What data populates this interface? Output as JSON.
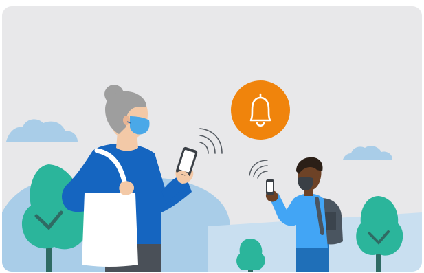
{
  "scene": {
    "icons": {
      "notification": "bell-icon",
      "signal": "wireless-signal-icon",
      "phone": "smartphone-icon"
    },
    "colors": {
      "background": "#e8e8ea",
      "hill": "#a9cde8",
      "cloud": "#a9cde8",
      "tree": "#2bb59b",
      "trunk": "#2f6b64",
      "bell_badge": "#f0840c",
      "jacket_woman": "#1565c0",
      "jacket_man": "#42a5f5",
      "mask": "#4aa8e8",
      "bag": "#ffffff",
      "hair_woman": "#9e9e9e",
      "skin_woman": "#f3c9a7",
      "skin_man": "#6d4226",
      "hair_man": "#2b1f17",
      "backpack": "#4a5560",
      "pants": "#4a5058"
    }
  }
}
